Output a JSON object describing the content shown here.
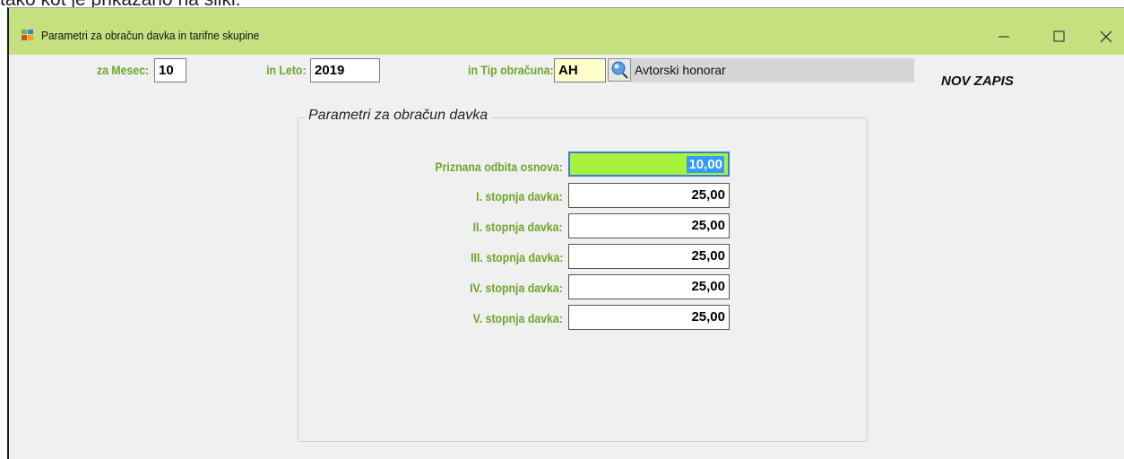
{
  "background_text": "tako kot je prikazano na sliki.",
  "window": {
    "title": "Parametri za obračun davka in tarifne skupine",
    "controls": {
      "minimize": "minimize-icon",
      "maximize": "maximize-icon",
      "close": "close-icon"
    },
    "titlebar_color": "#c5e07f"
  },
  "header": {
    "mesec_label": "za Mesec:",
    "mesec_value": "10",
    "leto_label": "in Leto:",
    "leto_value": "2019",
    "tip_label": "in Tip obračuna:",
    "tip_value": "AH",
    "tip_description": "Avtorski honorar",
    "status": "NOV ZAPIS",
    "label_color": "#6ea52a"
  },
  "group": {
    "title": "Parametri za obračun davka",
    "rows": [
      {
        "label": "Priznana odbita osnova:",
        "value": "10,00"
      },
      {
        "label": "I. stopnja davka:",
        "value": "25,00"
      },
      {
        "label": "II. stopnja davka:",
        "value": "25,00"
      },
      {
        "label": "III. stopnja davka:",
        "value": "25,00"
      },
      {
        "label": "IV. stopnja davka:",
        "value": "25,00"
      },
      {
        "label": "V. stopnja davka:",
        "value": "25,00"
      }
    ]
  }
}
